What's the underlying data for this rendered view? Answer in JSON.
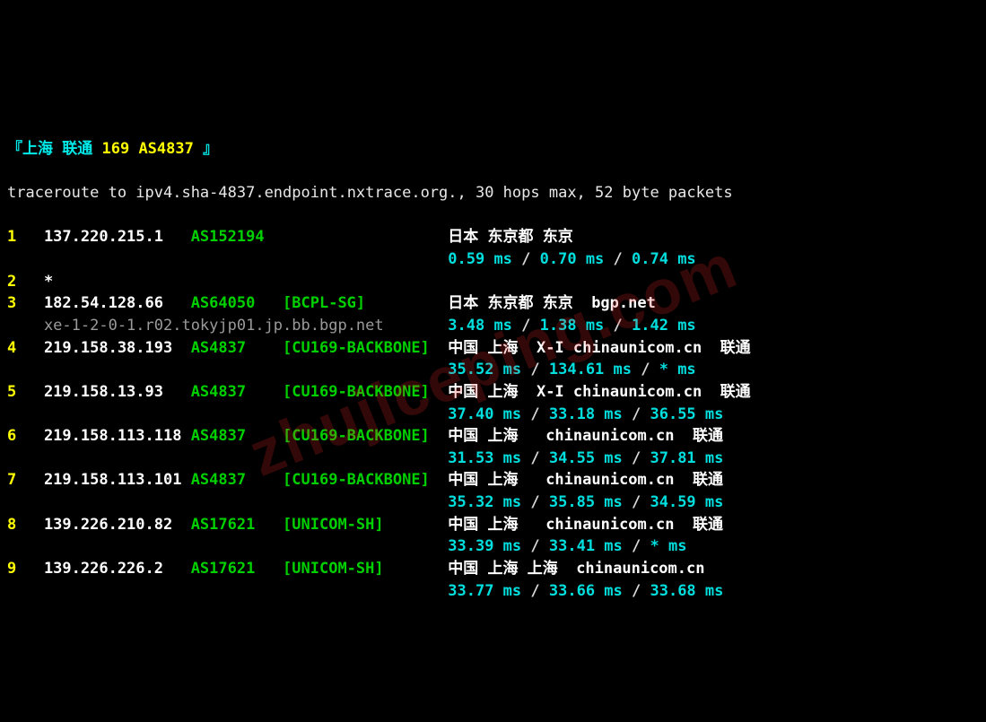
{
  "header": {
    "open": "『",
    "close": "』",
    "prefix_cn": "上海 联通",
    "asn_label": "169 AS4837"
  },
  "subline": "traceroute to ipv4.sha-4837.endpoint.nxtrace.org., 30 hops max, 52 byte packets",
  "watermark": "zhujiceping.com",
  "hops": [
    {
      "n": "1",
      "ip": "137.220.215.1",
      "asn": "AS152194",
      "tag": "",
      "loc": "日本 东京都 东京",
      "rdns": "",
      "t1": "0.59 ms",
      "t2": "0.70 ms",
      "t3": "0.74 ms"
    },
    {
      "n": "2",
      "star": "*"
    },
    {
      "n": "3",
      "ip": "182.54.128.66",
      "asn": "AS64050",
      "tag": "[BCPL-SG]",
      "loc": "日本 东京都 东京  bgp.net",
      "rdns": "xe-1-2-0-1.r02.tokyjp01.jp.bb.bgp.net",
      "t1": "3.48 ms",
      "t2": "1.38 ms",
      "t3": "1.42 ms"
    },
    {
      "n": "4",
      "ip": "219.158.38.193",
      "asn": "AS4837",
      "tag": "[CU169-BACKBONE]",
      "loc": "中国 上海  X-I chinaunicom.cn  联通",
      "t1": "35.52 ms",
      "t2": "134.61 ms",
      "t3": "* ms"
    },
    {
      "n": "5",
      "ip": "219.158.13.93",
      "asn": "AS4837",
      "tag": "[CU169-BACKBONE]",
      "loc": "中国 上海  X-I chinaunicom.cn  联通",
      "t1": "37.40 ms",
      "t2": "33.18 ms",
      "t3": "36.55 ms"
    },
    {
      "n": "6",
      "ip": "219.158.113.118",
      "asn": "AS4837",
      "tag": "[CU169-BACKBONE]",
      "loc": "中国 上海   chinaunicom.cn  联通",
      "t1": "31.53 ms",
      "t2": "34.55 ms",
      "t3": "37.81 ms"
    },
    {
      "n": "7",
      "ip": "219.158.113.101",
      "asn": "AS4837",
      "tag": "[CU169-BACKBONE]",
      "loc": "中国 上海   chinaunicom.cn  联通",
      "t1": "35.32 ms",
      "t2": "35.85 ms",
      "t3": "34.59 ms"
    },
    {
      "n": "8",
      "ip": "139.226.210.82",
      "asn": "AS17621",
      "tag": "[UNICOM-SH]",
      "loc": "中国 上海   chinaunicom.cn  联通",
      "t1": "33.39 ms",
      "t2": "33.41 ms",
      "t3": "* ms"
    },
    {
      "n": "9",
      "ip": "139.226.226.2",
      "asn": "AS17621",
      "tag": "[UNICOM-SH]",
      "loc": "中国 上海 上海  chinaunicom.cn",
      "t1": "33.77 ms",
      "t2": "33.66 ms",
      "t3": "33.68 ms"
    }
  ]
}
